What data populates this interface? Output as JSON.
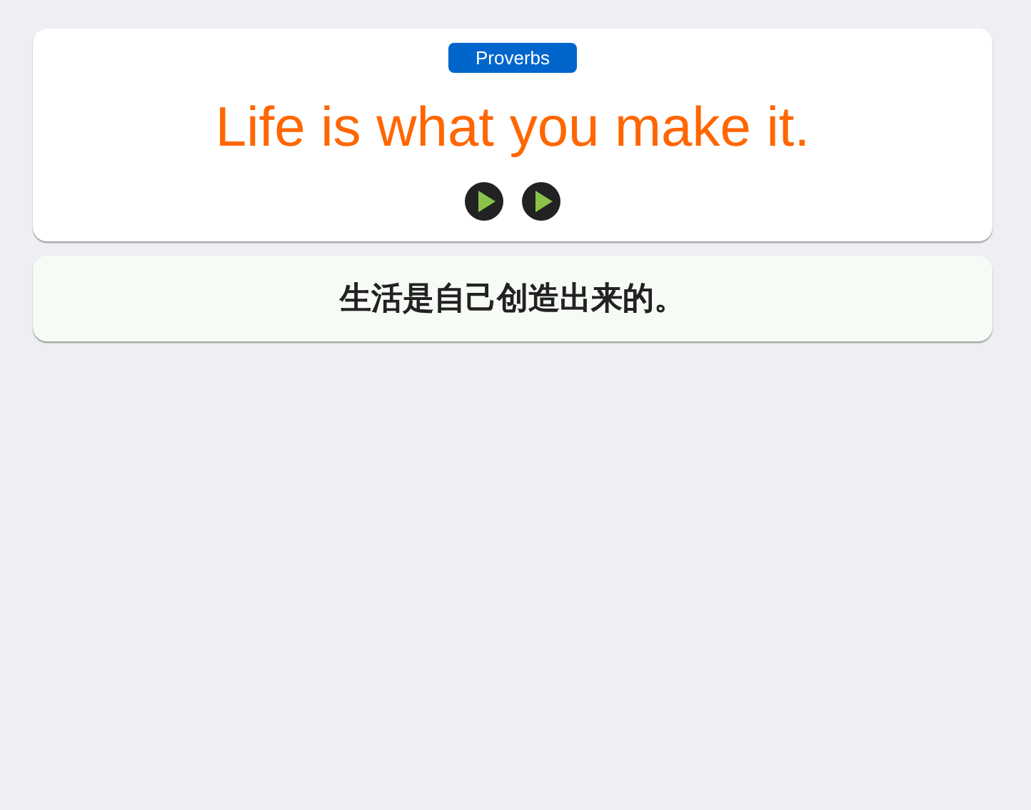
{
  "category": "Proverbs",
  "phrase": "Life is what you make it.",
  "play_buttons": [
    {
      "kind": "play"
    },
    {
      "kind": "play"
    }
  ],
  "translation": "生活是自己创造出来的。"
}
